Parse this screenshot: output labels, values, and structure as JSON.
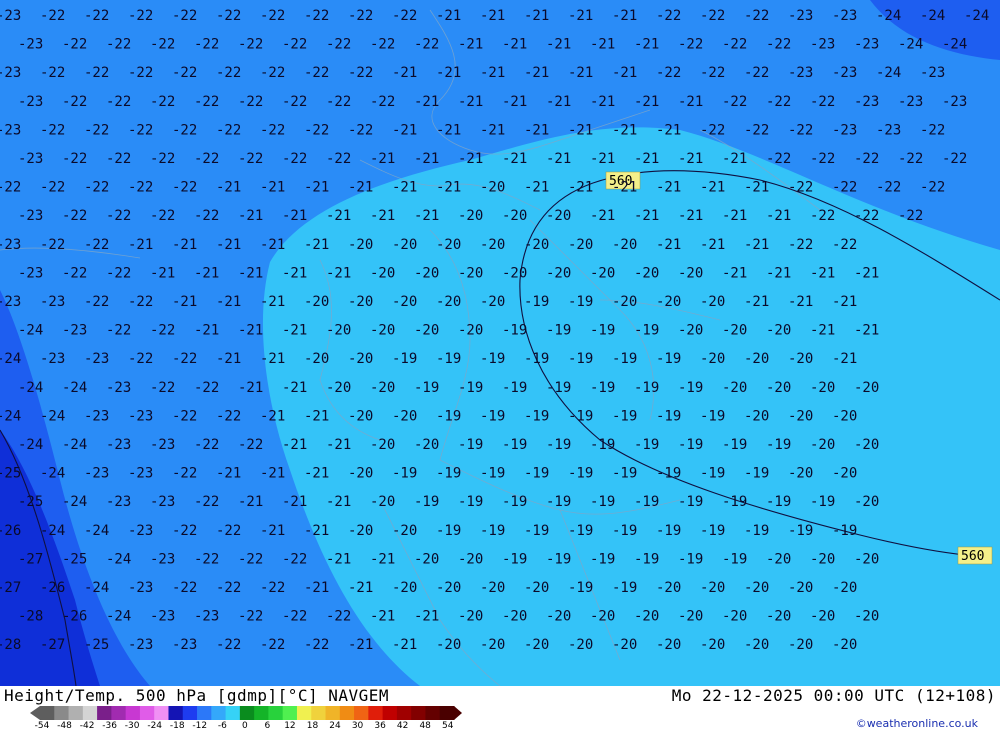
{
  "map": {
    "title": "Height/Temp. 500 hPa [gdmp][°C] NAVGEM",
    "valid": "Mo 22-12-2025 00:00 UTC (12+108)",
    "credit": "©weatheronline.co.uk",
    "contour_height_label": "560",
    "colors": {
      "band_minus27": "#0f2fd8",
      "band_minus24": "#1e5ef0",
      "band_minus21": "#2a8cf7",
      "band_minus18": "#34c3f8"
    },
    "colorbar": {
      "tick_labels": [
        "-54",
        "-48",
        "-42",
        "-36",
        "-30",
        "-24",
        "-18",
        "-12",
        "-6",
        "0",
        "6",
        "12",
        "18",
        "24",
        "30",
        "36",
        "42",
        "48",
        "54"
      ],
      "colors": [
        "#5e5e5e",
        "#8a8a8a",
        "#b0b0b0",
        "#d4d4d4",
        "#7a1f8a",
        "#a12bb0",
        "#c838d2",
        "#e05ce8",
        "#f090f4",
        "#1414b4",
        "#1e3cf0",
        "#2c78f8",
        "#34a8fa",
        "#36d2f6",
        "#0a8c1e",
        "#14b428",
        "#28d23c",
        "#50f050",
        "#f0f050",
        "#f0d23c",
        "#f0b428",
        "#f08c14",
        "#f06414",
        "#e01e0a",
        "#c00000",
        "#a00000",
        "#820000",
        "#640000",
        "#4a0000"
      ]
    },
    "temperature_labels": [
      {
        "row": 0,
        "values": [
          "-23",
          "-22",
          "-22",
          "-22",
          "-22",
          "-22",
          "-22",
          "-22",
          "-22",
          "-22",
          "-21",
          "-21",
          "-21",
          "-21",
          "-21",
          "-22",
          "-22",
          "-22",
          "-23",
          "-23",
          "-24",
          "-24",
          "-24",
          "-24"
        ]
      },
      {
        "row": 1,
        "values": [
          "-23",
          "-22",
          "-22",
          "-22",
          "-22",
          "-22",
          "-22",
          "-22",
          "-22",
          "-22",
          "-21",
          "-21",
          "-21",
          "-21",
          "-21",
          "-22",
          "-22",
          "-22",
          "-23",
          "-23",
          "-24",
          "-24",
          "-24"
        ]
      },
      {
        "row": 2,
        "values": [
          "-23",
          "-22",
          "-22",
          "-22",
          "-22",
          "-22",
          "-22",
          "-22",
          "-22",
          "-21",
          "-21",
          "-21",
          "-21",
          "-21",
          "-21",
          "-22",
          "-22",
          "-22",
          "-23",
          "-23",
          "-24",
          "-23"
        ]
      },
      {
        "row": 3,
        "values": [
          "-23",
          "-22",
          "-22",
          "-22",
          "-22",
          "-22",
          "-22",
          "-22",
          "-22",
          "-21",
          "-21",
          "-21",
          "-21",
          "-21",
          "-21",
          "-21",
          "-22",
          "-22",
          "-22",
          "-23",
          "-23",
          "-23"
        ]
      },
      {
        "row": 4,
        "values": [
          "-23",
          "-22",
          "-22",
          "-22",
          "-22",
          "-22",
          "-22",
          "-22",
          "-22",
          "-21",
          "-21",
          "-21",
          "-21",
          "-21",
          "-21",
          "-21",
          "-22",
          "-22",
          "-22",
          "-23",
          "-23",
          "-22"
        ]
      },
      {
        "row": 5,
        "values": [
          "-23",
          "-22",
          "-22",
          "-22",
          "-22",
          "-22",
          "-22",
          "-22",
          "-21",
          "-21",
          "-21",
          "-21",
          "-21",
          "-21",
          "-21",
          "-21",
          "-21",
          "-22",
          "-22",
          "-22",
          "-22",
          "-22"
        ]
      },
      {
        "row": 6,
        "values": [
          "-22",
          "-22",
          "-22",
          "-22",
          "-22",
          "-21",
          "-21",
          "-21",
          "-21",
          "-21",
          "-21",
          "-20",
          "-21",
          "-21",
          "-21",
          "-21",
          "-21",
          "-21",
          "-22",
          "-22",
          "-22",
          "-22"
        ]
      },
      {
        "row": 7,
        "values": [
          "-23",
          "-22",
          "-22",
          "-22",
          "-22",
          "-21",
          "-21",
          "-21",
          "-21",
          "-21",
          "-20",
          "-20",
          "-20",
          "-21",
          "-21",
          "-21",
          "-21",
          "-21",
          "-22",
          "-22",
          "-22"
        ]
      },
      {
        "row": 8,
        "values": [
          "-23",
          "-22",
          "-22",
          "-21",
          "-21",
          "-21",
          "-21",
          "-21",
          "-20",
          "-20",
          "-20",
          "-20",
          "-20",
          "-20",
          "-20",
          "-21",
          "-21",
          "-21",
          "-22",
          "-22"
        ]
      },
      {
        "row": 9,
        "values": [
          "-23",
          "-22",
          "-22",
          "-21",
          "-21",
          "-21",
          "-21",
          "-21",
          "-20",
          "-20",
          "-20",
          "-20",
          "-20",
          "-20",
          "-20",
          "-20",
          "-21",
          "-21",
          "-21",
          "-21"
        ]
      },
      {
        "row": 10,
        "values": [
          "-23",
          "-23",
          "-22",
          "-22",
          "-21",
          "-21",
          "-21",
          "-20",
          "-20",
          "-20",
          "-20",
          "-20",
          "-19",
          "-19",
          "-20",
          "-20",
          "-20",
          "-21",
          "-21",
          "-21"
        ]
      },
      {
        "row": 11,
        "values": [
          "-24",
          "-23",
          "-22",
          "-22",
          "-21",
          "-21",
          "-21",
          "-20",
          "-20",
          "-20",
          "-20",
          "-19",
          "-19",
          "-19",
          "-19",
          "-20",
          "-20",
          "-20",
          "-21",
          "-21"
        ]
      },
      {
        "row": 12,
        "values": [
          "-24",
          "-23",
          "-23",
          "-22",
          "-22",
          "-21",
          "-21",
          "-20",
          "-20",
          "-19",
          "-19",
          "-19",
          "-19",
          "-19",
          "-19",
          "-19",
          "-20",
          "-20",
          "-20",
          "-21"
        ]
      },
      {
        "row": 13,
        "values": [
          "-24",
          "-24",
          "-23",
          "-22",
          "-22",
          "-21",
          "-21",
          "-20",
          "-20",
          "-19",
          "-19",
          "-19",
          "-19",
          "-19",
          "-19",
          "-19",
          "-20",
          "-20",
          "-20",
          "-20"
        ]
      },
      {
        "row": 14,
        "values": [
          "-24",
          "-24",
          "-23",
          "-23",
          "-22",
          "-22",
          "-21",
          "-21",
          "-20",
          "-20",
          "-19",
          "-19",
          "-19",
          "-19",
          "-19",
          "-19",
          "-19",
          "-20",
          "-20",
          "-20"
        ]
      },
      {
        "row": 15,
        "values": [
          "-24",
          "-24",
          "-23",
          "-23",
          "-22",
          "-22",
          "-21",
          "-21",
          "-20",
          "-20",
          "-19",
          "-19",
          "-19",
          "-19",
          "-19",
          "-19",
          "-19",
          "-19",
          "-20",
          "-20"
        ]
      },
      {
        "row": 16,
        "values": [
          "-25",
          "-24",
          "-23",
          "-23",
          "-22",
          "-21",
          "-21",
          "-21",
          "-20",
          "-19",
          "-19",
          "-19",
          "-19",
          "-19",
          "-19",
          "-19",
          "-19",
          "-19",
          "-20",
          "-20"
        ]
      },
      {
        "row": 17,
        "values": [
          "-25",
          "-24",
          "-23",
          "-23",
          "-22",
          "-21",
          "-21",
          "-21",
          "-20",
          "-19",
          "-19",
          "-19",
          "-19",
          "-19",
          "-19",
          "-19",
          "-19",
          "-19",
          "-19",
          "-20"
        ]
      },
      {
        "row": 18,
        "values": [
          "-26",
          "-24",
          "-24",
          "-23",
          "-22",
          "-22",
          "-21",
          "-21",
          "-20",
          "-20",
          "-19",
          "-19",
          "-19",
          "-19",
          "-19",
          "-19",
          "-19",
          "-19",
          "-19",
          "-19"
        ]
      },
      {
        "row": 19,
        "values": [
          "-27",
          "-25",
          "-24",
          "-23",
          "-22",
          "-22",
          "-22",
          "-21",
          "-21",
          "-20",
          "-20",
          "-19",
          "-19",
          "-19",
          "-19",
          "-19",
          "-19",
          "-20",
          "-20",
          "-20"
        ]
      },
      {
        "row": 20,
        "values": [
          "-27",
          "-26",
          "-24",
          "-23",
          "-22",
          "-22",
          "-22",
          "-21",
          "-21",
          "-20",
          "-20",
          "-20",
          "-20",
          "-19",
          "-19",
          "-20",
          "-20",
          "-20",
          "-20",
          "-20"
        ]
      },
      {
        "row": 21,
        "values": [
          "-28",
          "-26",
          "-24",
          "-23",
          "-23",
          "-22",
          "-22",
          "-22",
          "-21",
          "-21",
          "-20",
          "-20",
          "-20",
          "-20",
          "-20",
          "-20",
          "-20",
          "-20",
          "-20",
          "-20"
        ]
      },
      {
        "row": 22,
        "values": [
          "-28",
          "-27",
          "-25",
          "-23",
          "-23",
          "-22",
          "-22",
          "-22",
          "-21",
          "-21",
          "-20",
          "-20",
          "-20",
          "-20",
          "-20",
          "-20",
          "-20",
          "-20",
          "-20",
          "-20"
        ]
      }
    ]
  }
}
